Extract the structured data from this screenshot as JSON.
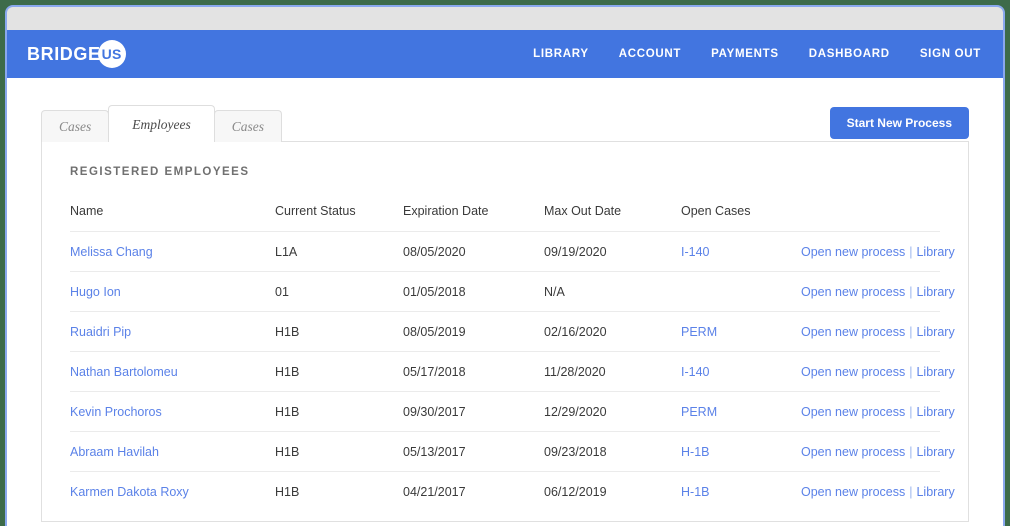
{
  "brand": {
    "word": "BRIDGE",
    "badge": "US"
  },
  "nav": {
    "items": [
      {
        "label": "LIBRARY",
        "name": "nav-link-library"
      },
      {
        "label": "ACCOUNT",
        "name": "nav-link-account"
      },
      {
        "label": "PAYMENTS",
        "name": "nav-link-payments"
      },
      {
        "label": "DASHBOARD",
        "name": "nav-link-dashboard"
      },
      {
        "label": "SIGN OUT",
        "name": "nav-link-sign-out"
      }
    ]
  },
  "tabs": [
    {
      "label": "Cases",
      "active": false
    },
    {
      "label": "Employees",
      "active": true
    },
    {
      "label": "Cases",
      "active": false
    }
  ],
  "toolbar": {
    "start_process_label": "Start New Process"
  },
  "card": {
    "title": "REGISTERED EMPLOYEES",
    "columns": [
      "Name",
      "Current Status",
      "Expiration Date",
      "Max Out Date",
      "Open Cases",
      ""
    ],
    "row_actions": {
      "open_new_process": "Open new process",
      "separator": "|",
      "library": "Library"
    },
    "rows": [
      {
        "name": "Melissa Chang",
        "current_status": "L1A",
        "expiration_date": "08/05/2020",
        "max_out_date": "09/19/2020",
        "open_cases": "I-140"
      },
      {
        "name": "Hugo Ion",
        "current_status": "01",
        "expiration_date": "01/05/2018",
        "max_out_date": "N/A",
        "open_cases": ""
      },
      {
        "name": "Ruaidri Pip",
        "current_status": "H1B",
        "expiration_date": "08/05/2019",
        "max_out_date": "02/16/2020",
        "open_cases": "PERM"
      },
      {
        "name": "Nathan Bartolomeu",
        "current_status": "H1B",
        "expiration_date": "05/17/2018",
        "max_out_date": "11/28/2020",
        "open_cases": "I-140"
      },
      {
        "name": "Kevin Prochoros",
        "current_status": "H1B",
        "expiration_date": "09/30/2017",
        "max_out_date": "12/29/2020",
        "open_cases": "PERM"
      },
      {
        "name": "Abraam Havilah",
        "current_status": "H1B",
        "expiration_date": "05/13/2017",
        "max_out_date": "09/23/2018",
        "open_cases": "H-1B"
      },
      {
        "name": "Karmen Dakota Roxy",
        "current_status": "H1B",
        "expiration_date": "04/21/2017",
        "max_out_date": "06/12/2019",
        "open_cases": "H-1B"
      }
    ]
  },
  "colors": {
    "brand_blue": "#4275e0",
    "link_blue": "#5b82e8",
    "desktop_green": "#3d6b4a",
    "chrome_gray": "#e3e3e3",
    "border_gray": "#e0e0e0"
  }
}
